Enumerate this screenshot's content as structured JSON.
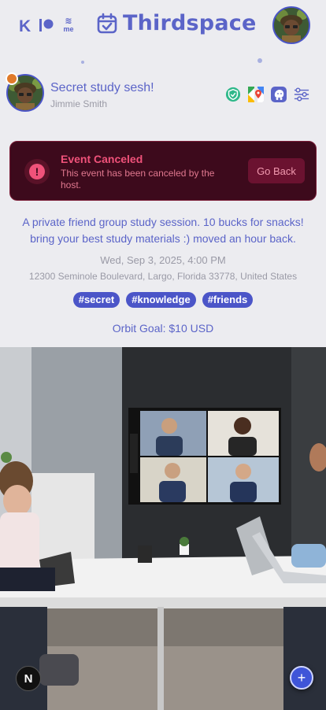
{
  "header": {
    "kofi_label": "K",
    "buymeacoffee_wave": "≋",
    "buymeacoffee_me": "me",
    "brand_title": "Thirdspace"
  },
  "event": {
    "title": "Secret study sesh!",
    "host": "Jimmie Smith",
    "description": "A private friend group study session. 10 bucks for snacks! bring your best study materials :) moved an hour back.",
    "datetime": "Wed, Sep 3, 2025, 4:00 PM",
    "address": "12300 Seminole Boulevard, Largo, Florida 33778, United States",
    "tags": [
      "#secret",
      "#knowledge",
      "#friends"
    ],
    "goal": "Orbit Goal: $10 USD"
  },
  "cancel_banner": {
    "icon": "!",
    "title": "Event Canceled",
    "message": "This event has been canceled by the host.",
    "button": "Go Back"
  },
  "floating": {
    "n_label": "N",
    "fab_label": "+"
  },
  "colors": {
    "brand": "#5b64c8",
    "banner_bg": "#3d0a1c",
    "banner_text": "#f0527a",
    "tag_bg": "#4b55c8"
  },
  "icons": [
    "verified-shield-icon",
    "google-maps-icon",
    "waze-icon",
    "settings-sliders-icon",
    "calendar-check-icon"
  ]
}
